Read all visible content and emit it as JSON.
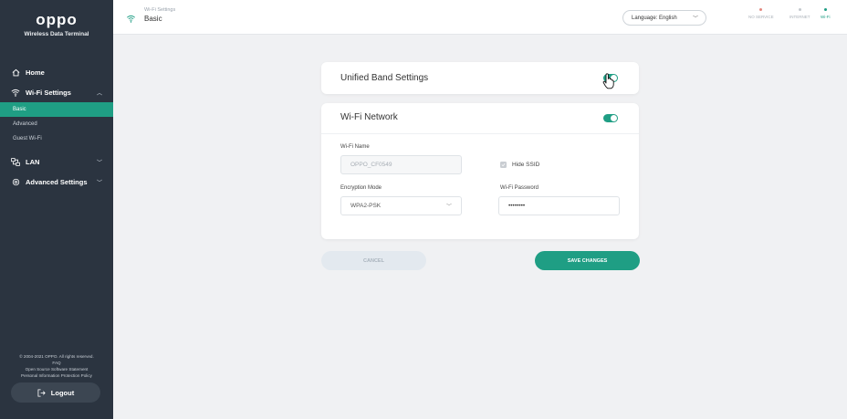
{
  "brand": {
    "logo": "oppo",
    "subtitle": "Wireless Data Terminal"
  },
  "sidebar": {
    "items": [
      {
        "label": "Home",
        "icon": "home-icon"
      },
      {
        "label": "Wi-Fi Settings",
        "icon": "wifi-icon",
        "expanded": true,
        "sub": [
          {
            "label": "Basic",
            "active": true
          },
          {
            "label": "Advanced"
          },
          {
            "label": "Guest Wi-Fi"
          }
        ]
      },
      {
        "label": "LAN",
        "icon": "lan-icon"
      },
      {
        "label": "Advanced Settings",
        "icon": "gear-icon"
      }
    ]
  },
  "footer": {
    "copyright": "© 2004-2021 OPPO. All rights reserved.",
    "faq": "FAQ",
    "open_source": "Open Source Software Statement",
    "privacy": "Personal Information Protection Policy",
    "logout": "Logout"
  },
  "header": {
    "breadcrumb_parent": "Wi-Fi Settings",
    "breadcrumb_current": "Basic",
    "language_label": "Language:",
    "language_value": "English",
    "status": [
      {
        "label": "NO SERVICE",
        "color": "#e4877d"
      },
      {
        "label": "INTERNET",
        "color": "#c3c8cd"
      },
      {
        "label": "Wi-Fi",
        "color": "#1f9e84"
      }
    ]
  },
  "unified_band": {
    "title": "Unified Band Settings",
    "enabled": true
  },
  "wifi_network": {
    "title": "Wi-Fi Network",
    "enabled": true,
    "name_label": "Wi-Fi Name",
    "name_value": "OPPO_CF0549",
    "hide_ssid_label": "Hide SSID",
    "encryption_label": "Encryption Mode",
    "encryption_value": "WPA2-PSK",
    "password_label": "Wi-Fi Password",
    "password_value": "••••••••"
  },
  "actions": {
    "cancel": "CANCEL",
    "save": "SAVE CHANGES"
  },
  "colors": {
    "accent": "#1f9e84",
    "sidebar_bg": "#2b3440"
  }
}
